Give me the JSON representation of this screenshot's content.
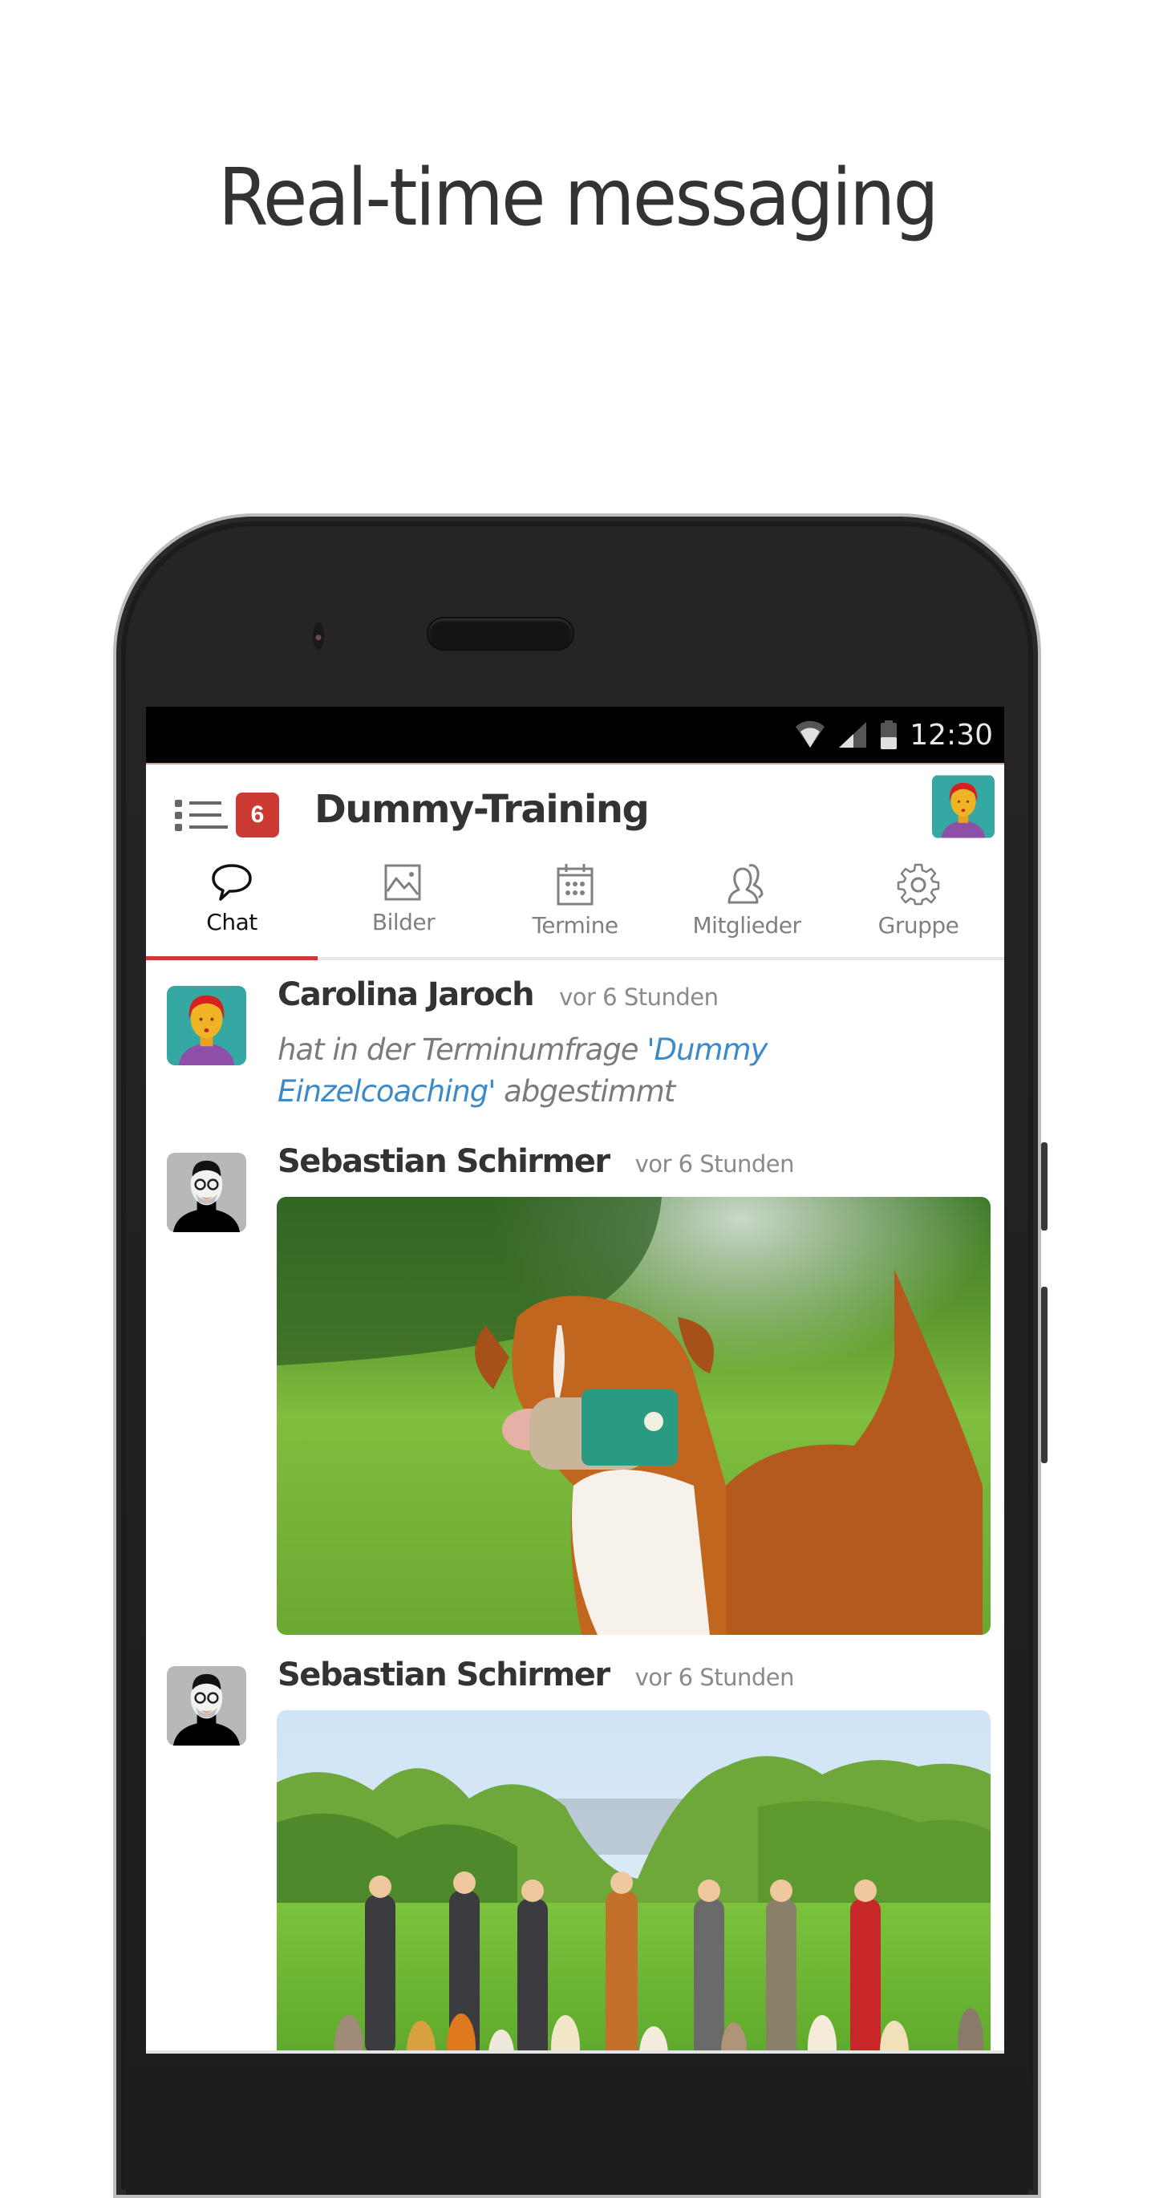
{
  "headline": "Real-time messaging",
  "status_bar": {
    "time": "12:30",
    "icons": [
      "wifi-icon",
      "signal-icon",
      "battery-icon"
    ]
  },
  "app_bar": {
    "menu_icon": "list-menu-icon",
    "notification_count": "6",
    "title": "Dummy-Training",
    "profile_avatar": "user-avatar"
  },
  "tabs": [
    {
      "label": "Chat",
      "icon": "chat-bubble-icon",
      "active": true
    },
    {
      "label": "Bilder",
      "icon": "image-icon",
      "active": false
    },
    {
      "label": "Termine",
      "icon": "calendar-icon",
      "active": false
    },
    {
      "label": "Mitglieder",
      "icon": "members-icon",
      "active": false
    },
    {
      "label": "Gruppe",
      "icon": "gear-icon",
      "active": false
    }
  ],
  "messages": [
    {
      "author": "Carolina Jaroch",
      "time": "vor 6 Stunden",
      "text_prefix": "hat in der Terminumfrage ",
      "text_link": "'Dummy Einzelcoaching'",
      "text_suffix": " abgestimmt",
      "avatar": "female-avatar"
    },
    {
      "author": "Sebastian Schirmer",
      "time": "vor 6 Stunden",
      "photo": "dog-retrieving-dummy-photo",
      "avatar": "male-avatar"
    },
    {
      "author": "Sebastian Schirmer",
      "time": "vor 6 Stunden",
      "photo": "group-with-dogs-photo",
      "avatar": "male-avatar"
    }
  ],
  "colors": {
    "accent": "#cc3b33",
    "link": "#3d8ac9",
    "avatar_teal": "#36a8a4",
    "avatar_gray": "#b8b8b8"
  }
}
